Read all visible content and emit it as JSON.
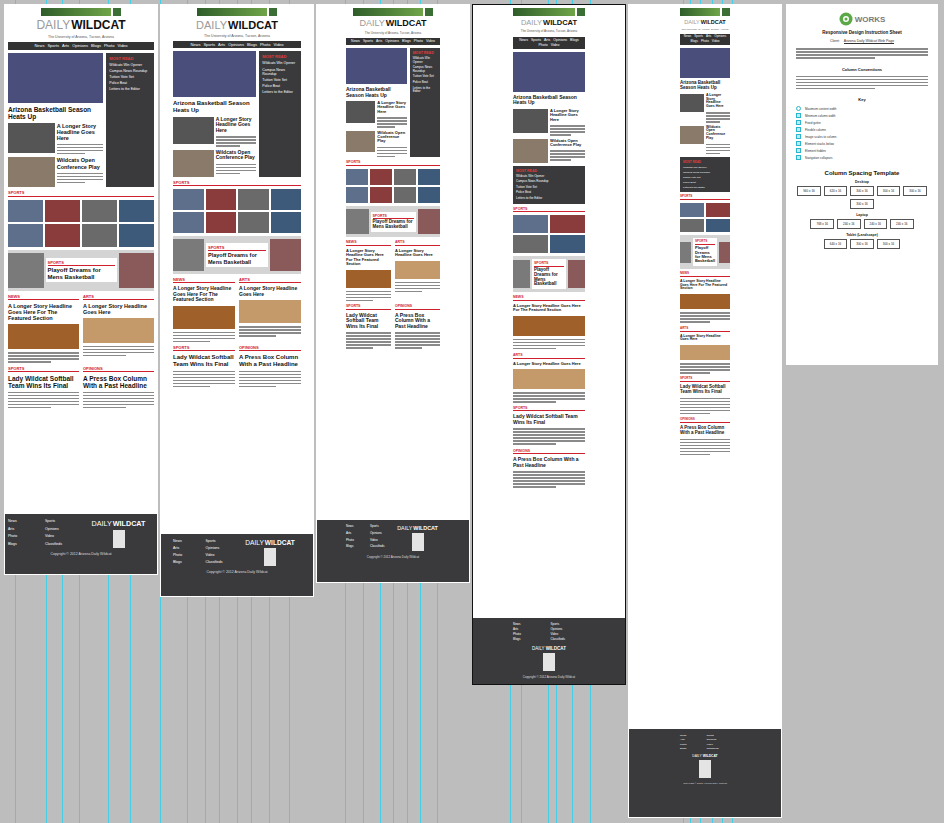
{
  "canvas": {
    "artboards": [
      {
        "kind": "desktop",
        "selected": false
      },
      {
        "kind": "laptop",
        "selected": false
      },
      {
        "kind": "tablet-landscape",
        "selected": false
      },
      {
        "kind": "tablet-portrait",
        "selected": true
      },
      {
        "kind": "phone",
        "selected": false
      }
    ]
  },
  "page": {
    "masthead": {
      "light": "DAILY",
      "bold": "WILDCAT"
    },
    "tagline": "The University of Arizona, Tucson, Arizona",
    "nav": [
      "News",
      "Sports",
      "Arts",
      "Opinions",
      "Blogs",
      "Photo",
      "Video"
    ],
    "lead": {
      "headline": "Arizona Basketball Season Heats Up"
    },
    "stories": [
      {
        "headline": "A Longer Story Headline Goes Here"
      },
      {
        "headline": "Wildcats Open Conference Play"
      }
    ],
    "sidebar": {
      "title": "MOST READ",
      "items": [
        "Wildcats Win Opener",
        "Campus News Roundup",
        "Tuition Vote Set",
        "Police Beat",
        "Letters to the Editor"
      ]
    },
    "strip": {
      "label": "SPORTS"
    },
    "feature": {
      "label": "SPORTS",
      "headline": "Playoff Dreams for Mens Basketball"
    },
    "sections": [
      {
        "label": "NEWS",
        "headline": "A Longer Story Headline Goes Here For The Featured Section"
      },
      {
        "label": "ARTS",
        "headline": "A Longer Story Headline Goes Here"
      }
    ],
    "columns": [
      {
        "label": "SPORTS",
        "headline": "Lady Wildcat Softball Team Wins Its Final"
      },
      {
        "label": "OPINIONS",
        "headline": "A Press Box Column With a Past Headline"
      }
    ],
    "footer": {
      "links": [
        "News",
        "Sports",
        "Arts",
        "Opinions",
        "Photo",
        "Video",
        "Blogs",
        "Classifieds"
      ],
      "brand_light": "DAILY",
      "brand_bold": "WILDCAT",
      "copyright": "Copyright © 2012 Arizona Daily Wildcat"
    }
  },
  "sheet": {
    "logo": "WORKS",
    "title": "Responsive Design Instruction Sheet",
    "field": {
      "label": "Client:",
      "value": "Arizona Daily Wildcat Web Page"
    },
    "conventions_title": "Column Conventions",
    "key_title": "Key",
    "key": [
      {
        "kind": "circle",
        "label": "Maximum content width"
      },
      {
        "kind": "square",
        "label": "Minimum column width"
      },
      {
        "kind": "square",
        "label": "Fixed gutter"
      },
      {
        "kind": "square",
        "label": "Flexible column"
      },
      {
        "kind": "square",
        "label": "Image scales to column"
      },
      {
        "kind": "square",
        "label": "Element stacks below"
      },
      {
        "kind": "square",
        "label": "Element hidden"
      },
      {
        "kind": "square",
        "label": "Navigation collapses"
      }
    ],
    "template": {
      "title": "Column Spacing Template",
      "groups": [
        {
          "name": "Desktop",
          "boxes": [
            "940 x 16",
            "620 x 16",
            "300 x 16",
            "300 x 16",
            "300 x 16",
            "300 x 16"
          ]
        },
        {
          "name": "Laptop",
          "boxes": [
            "768 x 16",
            "240 x 16",
            "240 x 16",
            "240 x 16"
          ]
        },
        {
          "name": "Tablet (Landscape)",
          "boxes": [
            "640 x 16",
            "300 x 16",
            "300 x 16"
          ]
        }
      ]
    }
  }
}
